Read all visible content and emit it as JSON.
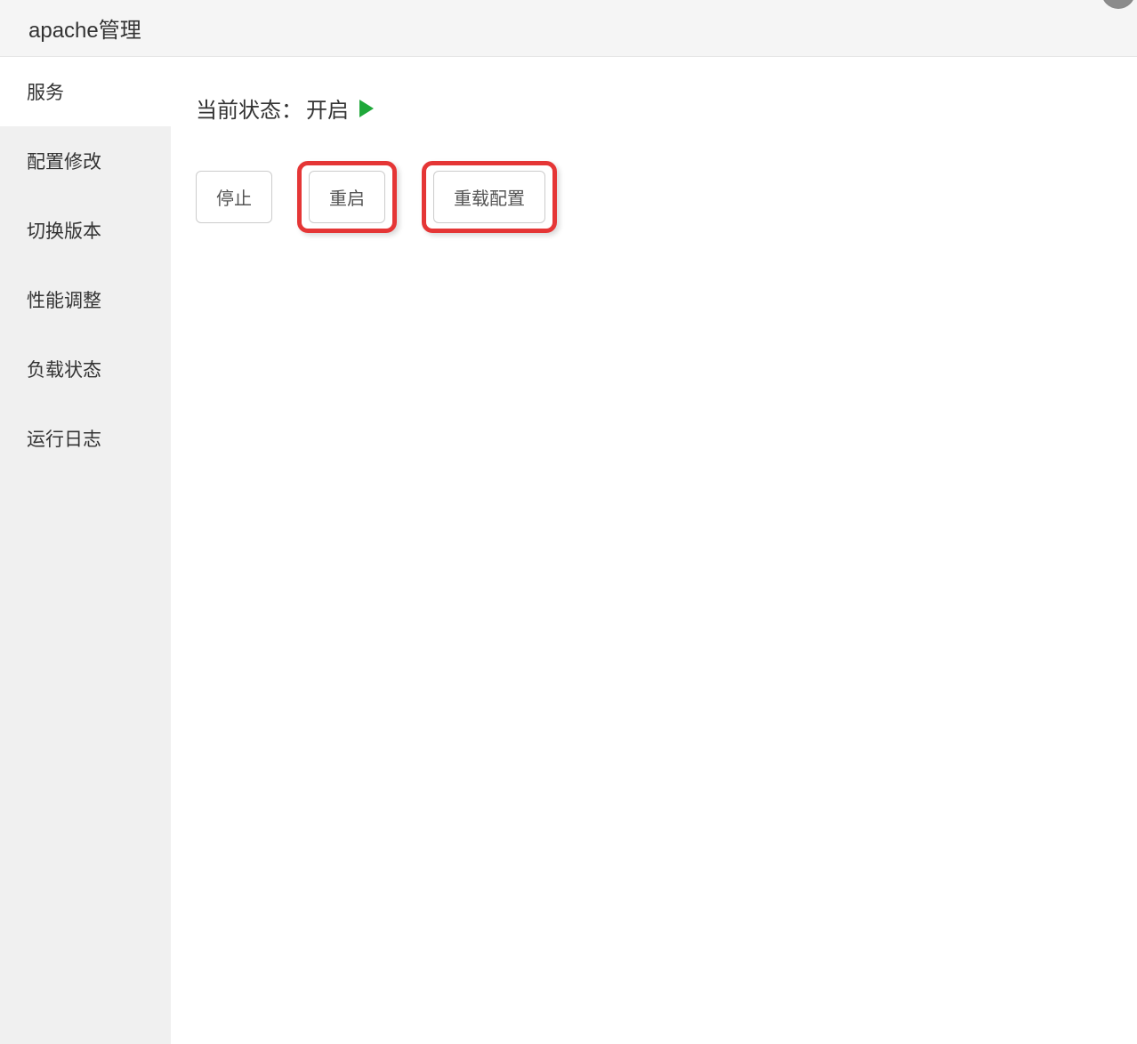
{
  "header": {
    "title": "apache管理"
  },
  "sidebar": {
    "items": [
      {
        "label": "服务",
        "active": true
      },
      {
        "label": "配置修改",
        "active": false
      },
      {
        "label": "切换版本",
        "active": false
      },
      {
        "label": "性能调整",
        "active": false
      },
      {
        "label": "负载状态",
        "active": false
      },
      {
        "label": "运行日志",
        "active": false
      }
    ]
  },
  "main": {
    "status_label": "当前状态：",
    "status_value": "开启",
    "buttons": {
      "stop": "停止",
      "restart": "重启",
      "reload": "重载配置"
    }
  }
}
